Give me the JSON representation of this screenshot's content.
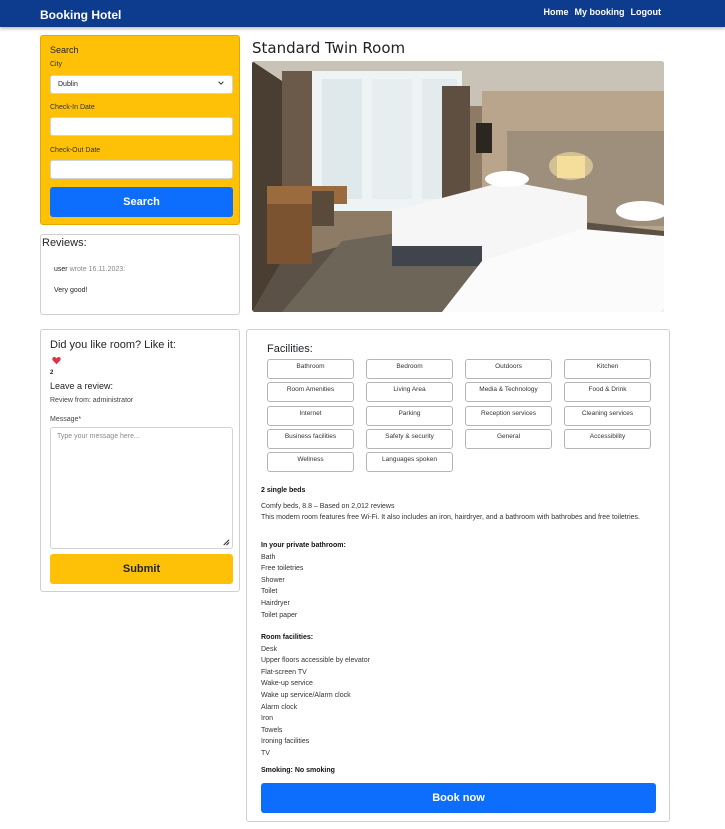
{
  "nav": {
    "brand": "Booking Hotel",
    "links": [
      "Home",
      "My booking",
      "Logout"
    ],
    "color": "#0d3b8e"
  },
  "search": {
    "title": "Search",
    "city_label": "City",
    "city_value": "Dublin",
    "checkin_label": "Check-In Date",
    "checkout_label": "Check-Out Date",
    "button": "Search",
    "color": "#ffc107"
  },
  "reviews": {
    "title": "Reviews:",
    "items": [
      {
        "user": "user",
        "wrote": "wrote 16.11.2023:",
        "message": "Very good!"
      }
    ]
  },
  "like": {
    "title": "Did you like room? Like it:",
    "icon": "heart-icon",
    "count": "2",
    "leave_title": "Leave a review:",
    "review_from": "Review from: administrator",
    "message_label": "Message*",
    "message_placeholder": "Type your message here...",
    "submit": "Submit"
  },
  "room": {
    "title": "Standard Twin Room"
  },
  "facilities": {
    "title": "Facilities:",
    "items": [
      "Bathroom",
      "Bedroom",
      "Outdoors",
      "Kitchen",
      "Room Amenities",
      "Living Area",
      "Media & Technology",
      "Food & Drink",
      "Internet",
      "Parking",
      "Reception services",
      "Cleaning services",
      "Business facilities",
      "Safety & security",
      "General",
      "Accessibility",
      "Wellness",
      "Languages spoken"
    ]
  },
  "details": {
    "beds": "2 single beds",
    "rating": "Comfy beds, 8.8 – Based on 2,012 reviews",
    "description": "This modern room features free Wi-Fi. It also includes an iron, hairdryer, and a bathroom with bathrobes and free toiletries.",
    "bathroom_title": "In your private bathroom:",
    "bathroom_items": [
      "Bath",
      "Free toiletries",
      "Shower",
      "Toilet",
      "Hairdryer",
      "Toilet paper"
    ],
    "room_title": "Room facilities:",
    "room_items": [
      "Desk",
      "Upper floors accessible by elevator",
      "Flat-screen TV",
      "Wake-up service",
      "Wake up service/Alarm clock",
      "Alarm clock",
      "Iron",
      "Towels",
      "Ironing facilities",
      "TV"
    ],
    "smoking_label": "Smoking:",
    "smoking_value": "No smoking",
    "book_button": "Book now",
    "button_color": "#0d6efd"
  }
}
